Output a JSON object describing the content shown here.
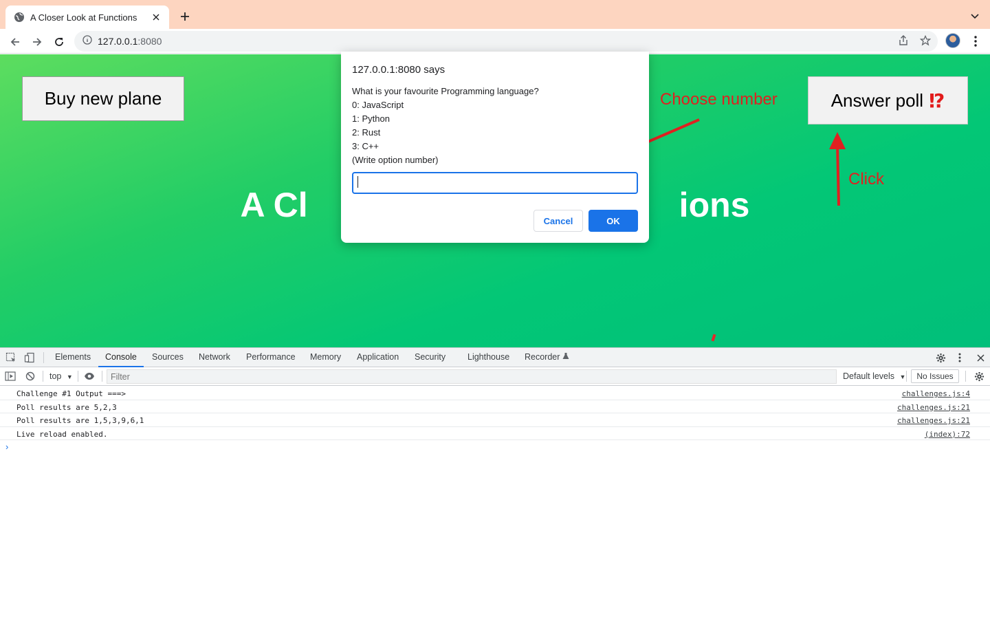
{
  "browser": {
    "tab_title": "A Closer Look at Functions",
    "url_host": "127.0.0.1",
    "url_port": ":8080"
  },
  "page": {
    "buy_button": "Buy new plane",
    "poll_button": "Answer poll",
    "poll_emoji": "⁉",
    "heading_left": "A Cl",
    "heading_right": "ions"
  },
  "annotations": {
    "choose_number": "Choose number",
    "click": "Click",
    "color": "#e02020"
  },
  "dialog": {
    "origin": "127.0.0.1:8080 says",
    "message_lines": [
      "What is your favourite Programming language?",
      "0: JavaScript",
      "1: Python",
      "2: Rust",
      "3: C++",
      "(Write option number)"
    ],
    "input_value": "",
    "cancel_label": "Cancel",
    "ok_label": "OK",
    "accent": "#1a73e8"
  },
  "devtools": {
    "tabs": [
      "Elements",
      "Console",
      "Sources",
      "Network",
      "Performance",
      "Memory",
      "Application",
      "Security",
      "Lighthouse",
      "Recorder"
    ],
    "active_tab": "Console",
    "context": "top",
    "filter_placeholder": "Filter",
    "levels": "Default levels",
    "issues": "No Issues",
    "logs": [
      {
        "message": "Challenge #1 Output ===>",
        "source": "challenges.js:4"
      },
      {
        "message": "Poll results are 5,2,3",
        "source": "challenges.js:21"
      },
      {
        "message": "Poll results are 1,5,3,9,6,1",
        "source": "challenges.js:21"
      },
      {
        "message": "Live reload enabled.",
        "source": "(index):72"
      }
    ]
  }
}
